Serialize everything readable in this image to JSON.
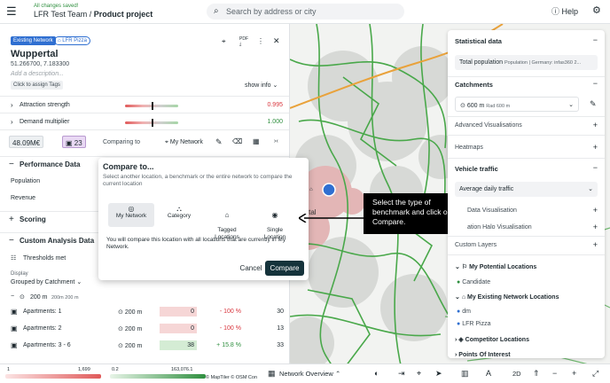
{
  "header": {
    "save_status": "All changes saved!",
    "team": "LFR Test Team",
    "separator": "/",
    "project": "Product project",
    "search_placeholder": "Search by address or city",
    "help_label": "Help"
  },
  "location": {
    "badge_network": "Existing Network",
    "badge_brand": "LFR Pizza",
    "pdf_label": "PDF",
    "name": "Wuppertal",
    "coords": "51.266700, 7.183300",
    "description_placeholder": "Add a description...",
    "assign_tags": "Click to assign Tags",
    "show_info": "show info"
  },
  "factors": [
    {
      "label": "Attraction strength",
      "value": "0.995",
      "color": "#d9363e",
      "knob": 0.5
    },
    {
      "label": "Demand multiplier",
      "value": "1.000",
      "color": "#2f8f3f",
      "knob": 0.5
    }
  ],
  "kpis": {
    "revenue": "48.09M€",
    "count": "23",
    "comparing_label": "Comparing to",
    "comparing_target": "My Network"
  },
  "sections": {
    "performance": "Performance Data",
    "population": "Population",
    "revenue": "Revenue",
    "scoring": "Scoring",
    "custom": "Custom Analysis Data",
    "thresholds": "Thresholds met",
    "display_label": "Display",
    "display_value": "Grouped by Catchment",
    "catchment_main": "200 m",
    "catchment_sub": "200m 200 m"
  },
  "table": [
    {
      "name": "Apartments: 1",
      "radius": "200 m",
      "value": "0",
      "pct": "- 100 %",
      "count": "30",
      "cell_color": "#f6d6d6",
      "pct_color": "#d9363e"
    },
    {
      "name": "Apartments: 2",
      "radius": "200 m",
      "value": "0",
      "pct": "- 100 %",
      "count": "13",
      "cell_color": "#f6d6d6",
      "pct_color": "#d9363e"
    },
    {
      "name": "Apartments: 3 - 6",
      "radius": "200 m",
      "value": "38",
      "pct": "+ 15.8 %",
      "count": "33",
      "cell_color": "#d4ecd4",
      "pct_color": "#2f8f3f"
    }
  ],
  "modal": {
    "title": "Compare to...",
    "subtitle": "Select another location, a benchmark or the entire network to compare the current location",
    "options": [
      {
        "label": "My Network",
        "icon": "◎"
      },
      {
        "label": "Category",
        "icon": "⛬"
      },
      {
        "label": "Tagged\nLocations",
        "icon": "⌂"
      },
      {
        "label": "Single\nLocation",
        "icon": "◉"
      }
    ],
    "info": "You will compare this location with all locations that are currently in My Network.",
    "cancel": "Cancel",
    "compare": "Compare"
  },
  "callout": {
    "text": "Select the type of benchmark and click on Compare."
  },
  "map": {
    "city_label": "ertal"
  },
  "right_panel": {
    "statistical": "Statistical data",
    "total_population": "Total population",
    "total_population_sub": "Population | Germany: infas360 2...",
    "catchments": "Catchments",
    "catchment_main": "600 m",
    "catchment_sub": "Rad 600 m",
    "advanced": "Advanced Visualisations",
    "heatmaps": "Heatmaps",
    "vehicle": "Vehicle traffic",
    "daily": "Average daily traffic",
    "data_vis": "Data Visualisation",
    "halo": "ation Halo Visualisation",
    "custom_layers": "Custom Layers",
    "potential": "My Potential Locations",
    "candidate": "Candidate",
    "existing": "My Existing Network Locations",
    "dm": "dm",
    "lfr": "LFR Pizza",
    "competitor": "Competitor Locations",
    "poi": "Points Of Interest"
  },
  "bottom": {
    "scale1_min": "1",
    "scale1_max": "1,699",
    "scale2_min": "0.2",
    "scale2_max": "163,076.1",
    "attribution": "© MapTiler  © OSM Con",
    "network_overview": "Network Overview",
    "mode_2d": "2D"
  }
}
